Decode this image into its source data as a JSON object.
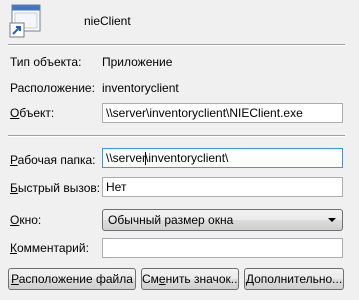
{
  "header": {
    "app_name": "nieClient",
    "icon": "application-shortcut-icon"
  },
  "info": {
    "type_label": "Тип объекта:",
    "type_value": "Приложение",
    "location_label": "Расположение:",
    "location_value": "inventoryclient"
  },
  "fields": {
    "target_label": "Объект:",
    "target_label_u": "О",
    "target_label_rest": "бъект:",
    "target_value": "\\\\server\\inventoryclient\\NIEClient.exe",
    "startin_label": "Рабочая папка:",
    "startin_label_u": "Р",
    "startin_label_rest": "абочая папка:",
    "startin_value_before_caret": "\\\\server",
    "startin_value_after_caret": "\\inventoryclient\\",
    "hotkey_label": "Быстрый вызов:",
    "hotkey_label_u": "Б",
    "hotkey_label_rest": "ыстрый вызов:",
    "hotkey_value": "Нет",
    "run_label": "Окно:",
    "run_label_u": "О",
    "run_label_rest": "кно:",
    "run_value": "Обычный размер окна",
    "comment_label": "Комментарий:",
    "comment_label_u": "К",
    "comment_label_rest": "омментарий:",
    "comment_value": ""
  },
  "buttons": {
    "open_location": "Расположение файла",
    "open_location_u": "Р",
    "open_location_rest": "асположение файла",
    "change_icon": "Сменить значок...",
    "change_icon_before": "См",
    "change_icon_u": "е",
    "change_icon_rest": "нить значок...",
    "advanced": "Дополнительно...",
    "advanced_u": "Д",
    "advanced_rest": "ополнительно..."
  }
}
